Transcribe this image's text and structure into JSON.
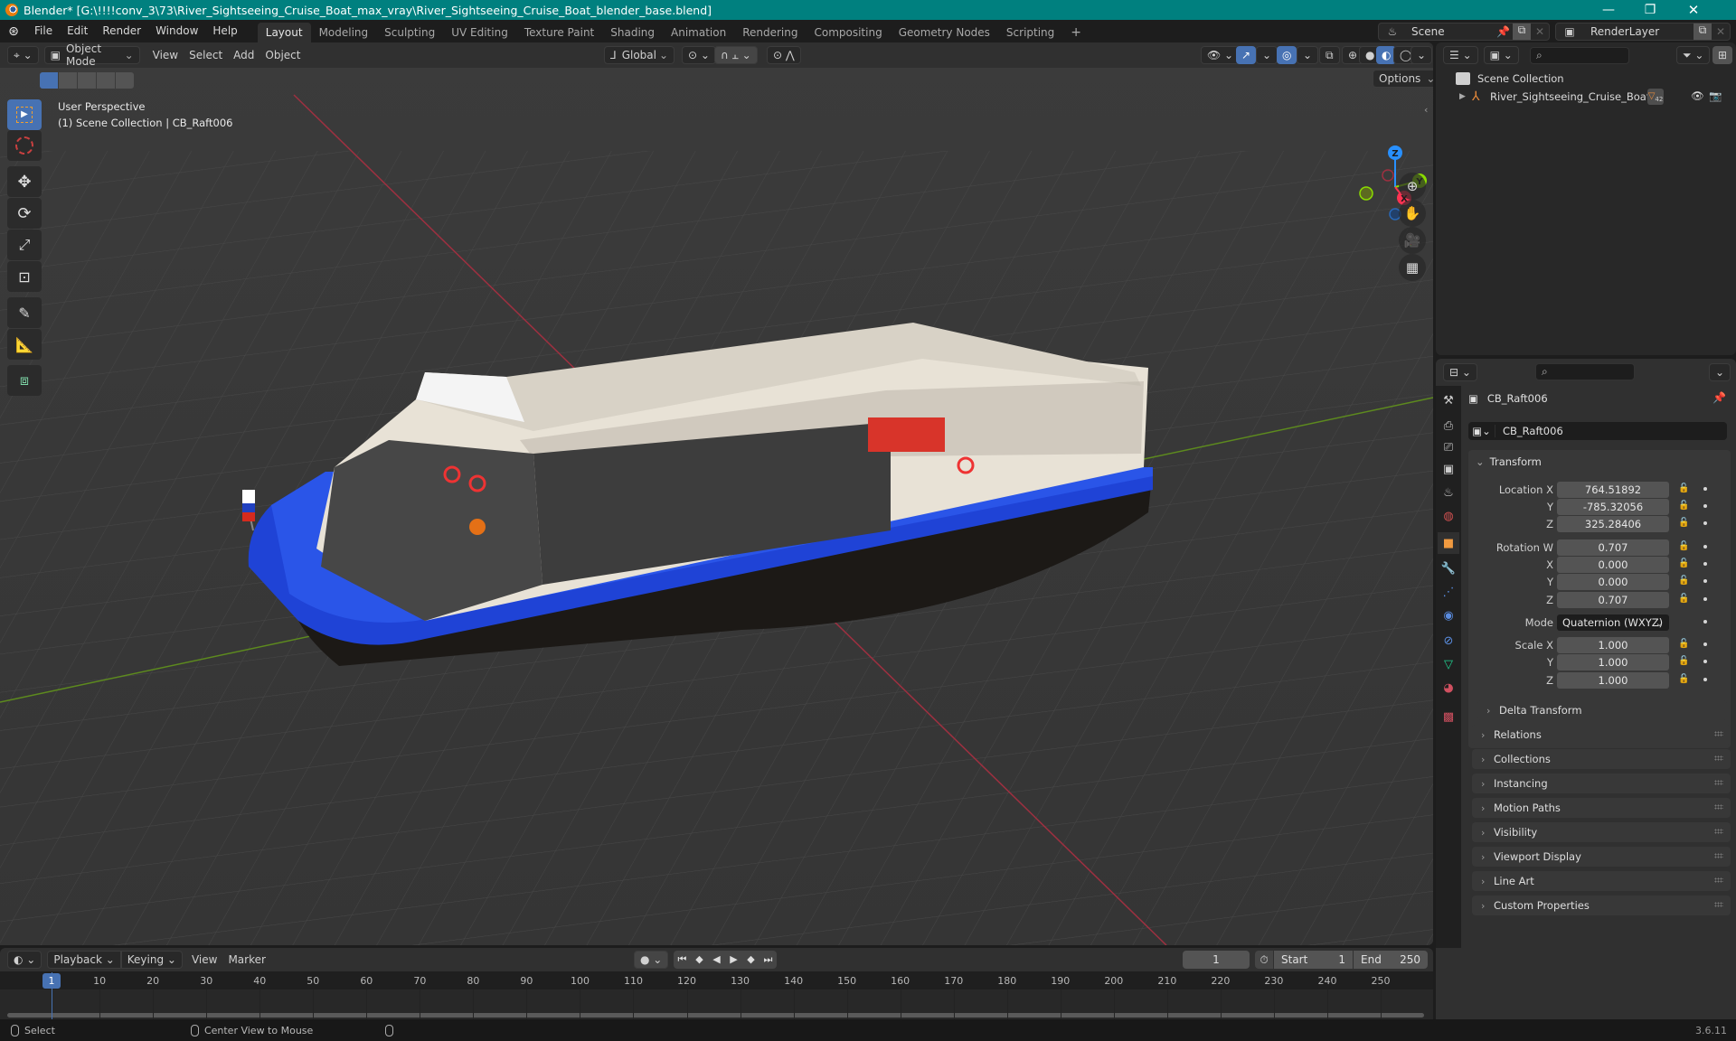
{
  "titlebar": {
    "title": "Blender* [G:\\!!!!conv_3\\73\\River_Sightseeing_Cruise_Boat_max_vray\\River_Sightseeing_Cruise_Boat_blender_base.blend]",
    "minimize": "—",
    "maximize": "❐",
    "close": "✕"
  },
  "menubar": {
    "menus": [
      "File",
      "Edit",
      "Render",
      "Window",
      "Help"
    ],
    "workspaces": [
      "Layout",
      "Modeling",
      "Sculpting",
      "UV Editing",
      "Texture Paint",
      "Shading",
      "Animation",
      "Rendering",
      "Compositing",
      "Geometry Nodes",
      "Scripting"
    ],
    "active_workspace": "Layout",
    "add_workspace": "+",
    "scene": "Scene",
    "view_layer": "RenderLayer"
  },
  "viewport": {
    "mode": "Object Mode",
    "menus": [
      "View",
      "Select",
      "Add",
      "Object"
    ],
    "orientation": "Global",
    "options_label": "Options",
    "overlay_line1": "User Perspective",
    "overlay_line2": "(1) Scene Collection | CB_Raft006",
    "gizmo": {
      "x": "X",
      "y": "Y",
      "z": "Z"
    },
    "colors": {
      "x_axis": "#ff3352",
      "y_axis": "#8bdc00",
      "z_axis": "#2890ff",
      "grid_bg": "#393939",
      "accent": "#4772b3"
    },
    "tools": [
      "select-box",
      "cursor",
      "move",
      "rotate",
      "scale",
      "transform",
      "annotate",
      "measure",
      "add-cube"
    ]
  },
  "outliner": {
    "root": "Scene Collection",
    "items": [
      {
        "name": "River_Sightseeing_Cruise_Boat",
        "badge": "42"
      }
    ]
  },
  "properties": {
    "object_name": "CB_Raft006",
    "datablock_name": "CB_Raft006",
    "transform_title": "Transform",
    "location": {
      "label": "Location X",
      "x": "764.51892",
      "y": "-785.32056",
      "z": "325.28406"
    },
    "rotation": {
      "label": "Rotation W",
      "w": "0.707",
      "x": "0.000",
      "y": "0.000",
      "z": "0.707"
    },
    "mode_label": "Mode",
    "mode_value": "Quaternion (WXYZ)",
    "scale": {
      "label": "Scale X",
      "x": "1.000",
      "y": "1.000",
      "z": "1.000"
    },
    "axis_labels": {
      "y": "Y",
      "z": "Z",
      "x": "X"
    },
    "delta_transform": "Delta Transform",
    "panels": [
      "Relations",
      "Collections",
      "Instancing",
      "Motion Paths",
      "Visibility",
      "Viewport Display",
      "Line Art",
      "Custom Properties"
    ]
  },
  "timeline": {
    "menus": [
      "Playback",
      "Keying",
      "View",
      "Marker"
    ],
    "current_frame": "1",
    "start_label": "Start",
    "start": "1",
    "end_label": "End",
    "end": "250",
    "ticks": [
      "10",
      "20",
      "30",
      "40",
      "50",
      "60",
      "70",
      "80",
      "90",
      "100",
      "110",
      "120",
      "130",
      "140",
      "150",
      "160",
      "170",
      "180",
      "190",
      "200",
      "210",
      "220",
      "230",
      "240",
      "250"
    ],
    "playhead": "1"
  },
  "statusbar": {
    "select": "Select",
    "center_view": "Center View to Mouse",
    "version": "3.6.11"
  }
}
